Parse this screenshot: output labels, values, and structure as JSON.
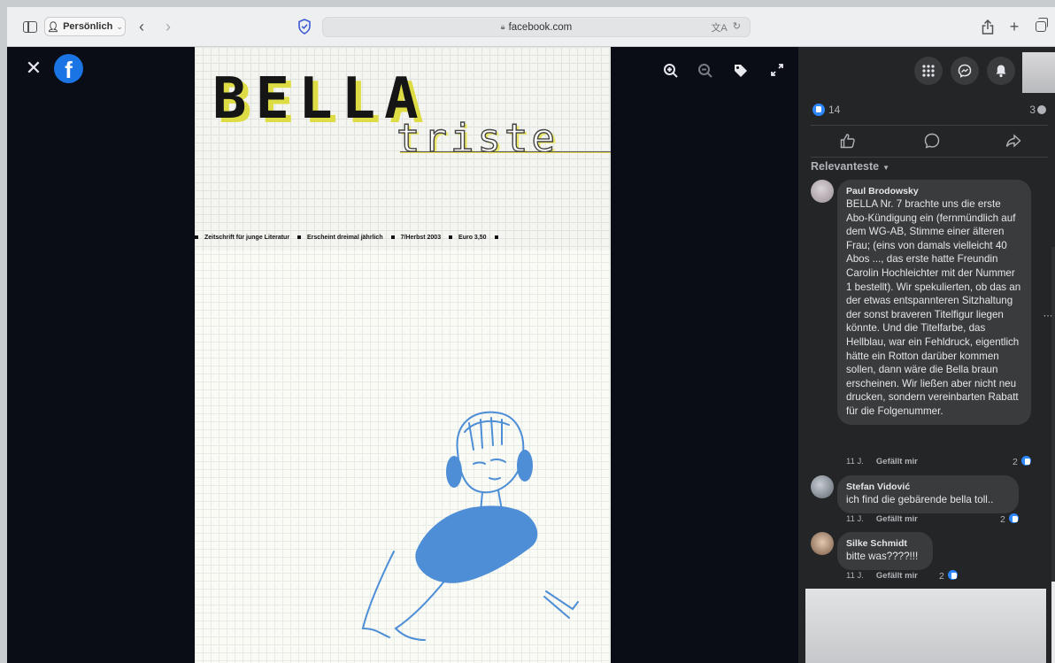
{
  "browser": {
    "profile_label": "Persönlich",
    "address": "facebook.com"
  },
  "magazine": {
    "title": "BELLA",
    "subtitle": "triste",
    "tagline": [
      "Zeitschrift für junge Literatur",
      "Erscheint dreimal jährlich",
      "7/Herbst 2003",
      "Euro 3,50"
    ]
  },
  "post": {
    "reaction_count": "14",
    "comment_count": "3",
    "sort_label": "Relevanteste"
  },
  "comments": [
    {
      "author": "Paul Brodowsky",
      "text": "BELLA Nr. 7 brachte uns die erste Abo-Kündigung ein (fernmündlich auf dem WG-AB, Stimme einer älteren Frau; (eins von damals vielleicht 40 Abos ..., das erste hatte Freundin Carolin Hochleichter mit der Nummer 1 bestellt). Wir spekulierten, ob das an der etwas entspannteren Sitzhaltung der sonst braveren Titelfigur liegen könnte. Und die Titelfarbe, das Hellblau, war ein Fehldruck, eigentlich hätte ein Rotton darüber kommen sollen, dann wäre die Bella braun erscheinen. Wir ließen aber nicht neu drucken, sondern vereinbarten Rabatt für die Folgenummer.",
      "age": "11 J.",
      "like_label": "Gefällt mir",
      "likes": "2"
    },
    {
      "author": "Stefan Vidović",
      "text": "ich find die gebärende bella toll..",
      "age": "11 J.",
      "like_label": "Gefällt mir",
      "likes": "2"
    },
    {
      "author": "Silke Schmidt",
      "text": "bitte was????!!!",
      "age": "11 J.",
      "like_label": "Gefällt mir",
      "likes": "2"
    }
  ],
  "colors": {
    "facebook_blue": "#1b74e4",
    "like_blue": "#2d88ff",
    "panel_bg": "#242527",
    "bubble_bg": "#3a3b3c",
    "illustration_blue": "#4d8ed6",
    "title_yellow": "#dedc45"
  },
  "icons": [
    "sidebar-icon",
    "person-icon",
    "chevron-left-icon",
    "chevron-right-icon",
    "shield-icon",
    "lock-icon",
    "translate-icon",
    "reload-icon",
    "share-icon",
    "plus-icon",
    "tabs-icon",
    "close-icon",
    "facebook-icon",
    "zoom-in-icon",
    "zoom-out-icon",
    "tag-icon",
    "expand-icon",
    "grid-menu-icon",
    "messenger-icon",
    "bell-icon",
    "thumbs-up-icon",
    "comment-icon",
    "share-arrow-icon"
  ]
}
